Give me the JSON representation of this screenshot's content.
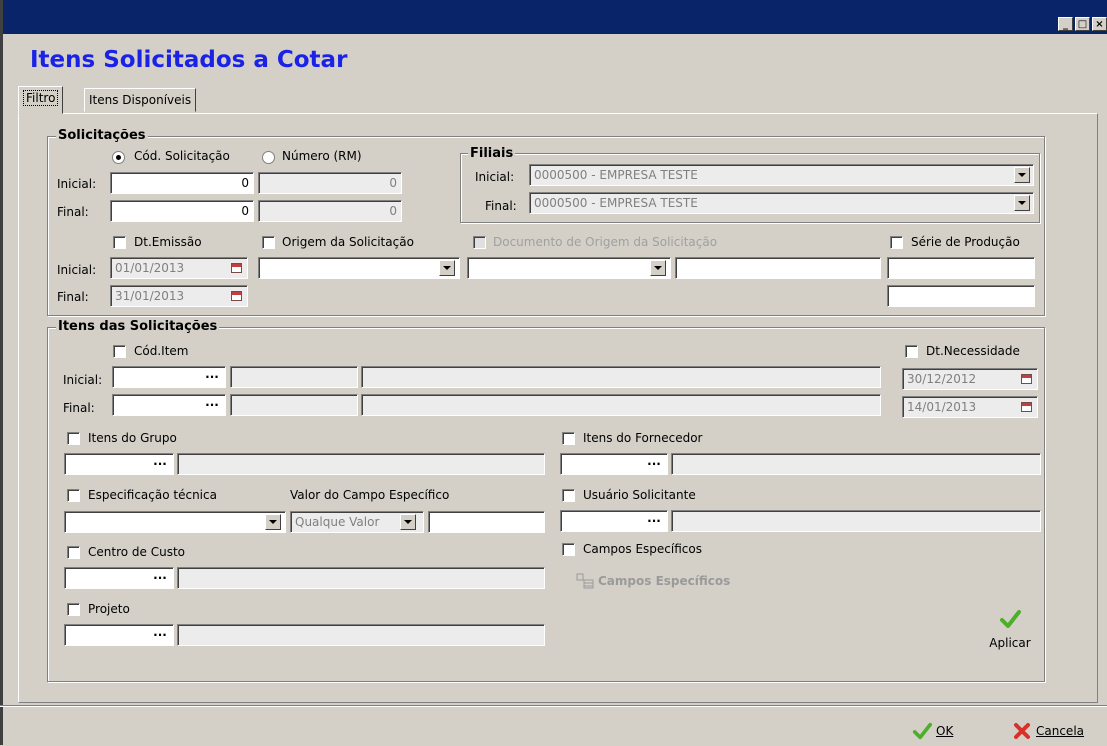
{
  "window": {
    "title": "Itens Solicitados a Cotar",
    "controls": [
      "_",
      "□",
      "×"
    ]
  },
  "tabs": [
    {
      "label": "Filtro"
    },
    {
      "label": "Itens Disponíveis"
    }
  ],
  "solicitacoes": {
    "title": "Solicitações",
    "radio_cod": "Cód. Solicitação",
    "radio_numero": "Número (RM)",
    "selected": "cod",
    "inicial_label": "Inicial:",
    "final_label": "Final:",
    "cod_inicial": "0",
    "cod_final": "0",
    "rm_inicial": "0",
    "rm_final": "0",
    "dt_emissao_label": "Dt.Emissão",
    "dt_inicial": "01/01/2013",
    "dt_final": "31/01/2013",
    "origem_label": "Origem da Solicitação",
    "origem_value": "",
    "documento_label": "Documento de Origem da Solicitação",
    "documento_value": "",
    "documento_extra": "",
    "serie_label": "Série de Produção",
    "serie_inicial": "",
    "serie_final": ""
  },
  "filiais": {
    "title": "Filiais",
    "inicial_label": "Inicial:",
    "final_label": "Final:",
    "inicial_value": "0000500 - EMPRESA TESTE",
    "final_value": "0000500 - EMPRESA TESTE"
  },
  "itens": {
    "title": "Itens das Solicitações",
    "cod_item_label": "Cód.Item",
    "inicial_label": "Inicial:",
    "final_label": "Final:",
    "dt_necessidade_label": "Dt.Necessidade",
    "dt_nec_inicial": "30/12/2012",
    "dt_nec_final": "14/01/2013",
    "grupo_label": "Itens do Grupo",
    "fornecedor_label": "Itens do Fornecedor",
    "espec_label": "Especificação técnica",
    "valor_campo_label": "Valor do Campo Específico",
    "valor_campo_select": "Qualque Valor",
    "usuario_label": "Usuário Solicitante",
    "centro_label": "Centro de Custo",
    "campos_label": "Campos Específicos",
    "campos_button": "Campos Específicos",
    "projeto_label": "Projeto",
    "aplicar": "Aplicar"
  },
  "footer": {
    "ok": "OK",
    "cancela": "Cancela"
  },
  "colors": {
    "title_blue": "#1a22e6",
    "titlebar": "#0a246a",
    "face": "#d4d0c8",
    "ok_green": "#4caf2a",
    "cancel_red": "#d9302a"
  }
}
